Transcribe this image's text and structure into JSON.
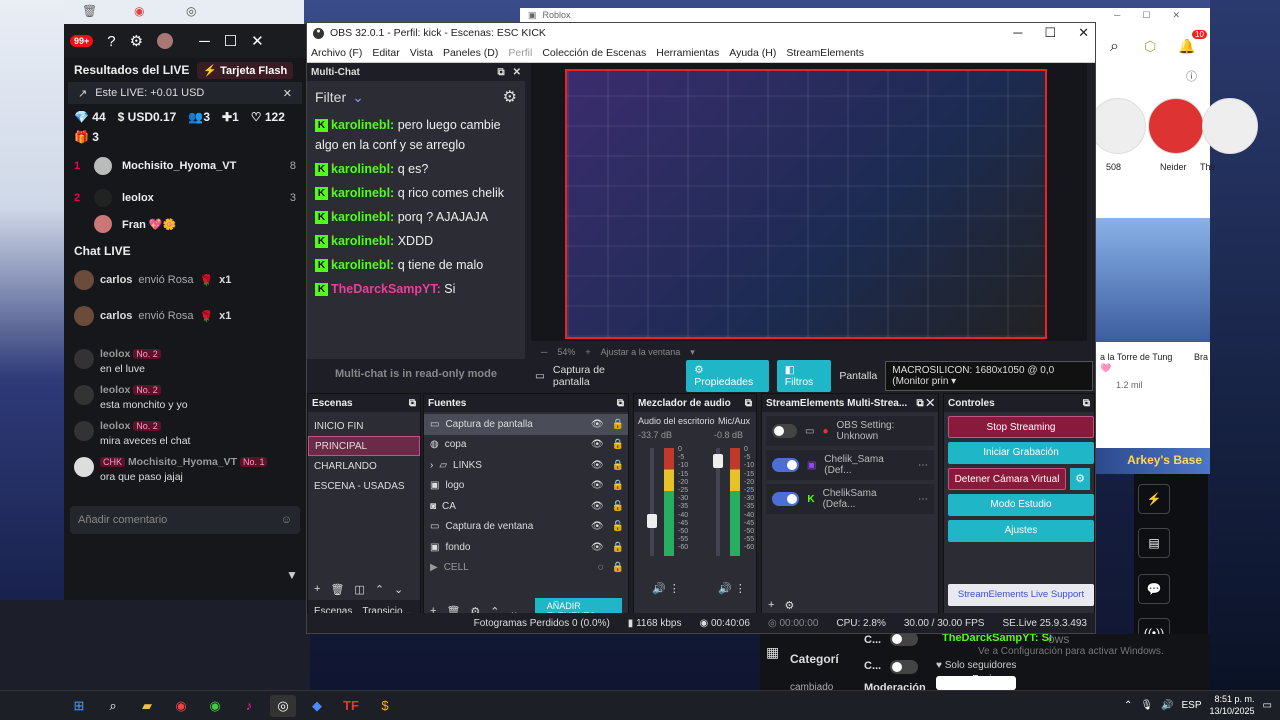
{
  "kick": {
    "notif_count": "99+",
    "header_title": "Resultados del LIVE",
    "tarjeta_flash": "Tarjeta Flash",
    "live_bar": "Este LIVE: +0.01 USD",
    "stats": {
      "diamonds": "44",
      "usd": "USD0.17",
      "users": "3",
      "fans": "1",
      "likes": "122",
      "gifts": "3"
    },
    "ranking": [
      {
        "n": "1",
        "name": "Mochisito_Hyoma_VT",
        "score": "8"
      },
      {
        "n": "2",
        "name": "leolox",
        "score": "3"
      },
      {
        "n": "",
        "name": "Fran 💖🌼",
        "score": ""
      }
    ],
    "chat_live_title": "Chat LIVE",
    "gifts": [
      {
        "user": "carlos",
        "text": "envió Rosa",
        "count": "x1"
      },
      {
        "user": "carlos",
        "text": "envió Rosa",
        "count": "x1"
      }
    ],
    "messages": [
      {
        "user": "leolox",
        "badge": "No. 2",
        "text": "en el luve"
      },
      {
        "user": "leolox",
        "badge": "No. 2",
        "text": "esta monchito y yo"
      },
      {
        "user": "leolox",
        "badge": "No. 2",
        "text": "mira aveces el chat"
      },
      {
        "user": "Mochisito_Hyoma_VT",
        "tag": "CHK",
        "badge": "No. 1",
        "text": "ora que paso jajaj"
      }
    ],
    "comment_placeholder": "Añadir comentario"
  },
  "obs": {
    "title": "OBS 32.0.1 - Perfil: kick - Escenas: ESC KICK",
    "menu": [
      "Archivo (F)",
      "Editar",
      "Vista",
      "Paneles (D)",
      "Perfil",
      "Colección de Escenas",
      "Herramientas",
      "Ayuda (H)",
      "StreamElements"
    ],
    "multichat": {
      "title": "Multi-Chat",
      "filter": "Filter",
      "lines": [
        {
          "user": "karolinebl:",
          "text": "pero luego cambie algo en la conf y se arreglo"
        },
        {
          "user": "karolinebl:",
          "text": "q es?"
        },
        {
          "user": "karolinebl:",
          "text": "q rico comes chelik"
        },
        {
          "user": "karolinebl:",
          "text": "porq ? AJAJAJA"
        },
        {
          "user": "karolinebl:",
          "text": "XDDD"
        },
        {
          "user": "karolinebl:",
          "text": "q tiene de malo"
        },
        {
          "user": "TheDarckSampYT:",
          "text": "Si"
        }
      ],
      "readonly": "Multi-chat is in read-only mode"
    },
    "zoom": "54%",
    "fit": "Ajustar a la ventana",
    "source_bar": {
      "source": "Captura de pantalla",
      "props": "Propiedades",
      "filters": "Filtros",
      "screen_label": "Pantalla",
      "screen_value": "MACROSILICON: 1680x1050 @ 0,0 (Monitor prin"
    },
    "scenes": {
      "title": "Escenas",
      "items": [
        "INICIO FIN",
        "PRINCIPAL",
        "CHARLANDO",
        "ESCENA - USADAS"
      ],
      "tab1": "Escenas",
      "tab2": "Transicio..."
    },
    "sources": {
      "title": "Fuentes",
      "items": [
        "Captura de pantalla",
        "copa",
        "LINKS",
        "logo",
        "CA",
        "Captura de ventana",
        "fondo",
        "CELL"
      ],
      "add_element": "AÑADIR ELEMENTO"
    },
    "mixer": {
      "title": "Mezclador de audio",
      "ch1": "Audio del escritorio",
      "ch1_db": "-33.7 dB",
      "ch2": "Mic/Aux",
      "ch2_db": "-0.8 dB",
      "scale": [
        "0",
        "-5",
        "-10",
        "-15",
        "-20",
        "-25",
        "-30",
        "-35",
        "-40",
        "-45",
        "-50",
        "-55",
        "-60"
      ]
    },
    "se": {
      "title": "StreamElements Multi-Strea...",
      "rows": [
        "OBS Setting: Unknown",
        "Chelik_Sama (Def...",
        "ChelikSama (Defa..."
      ]
    },
    "controls": {
      "title": "Controles",
      "stop": "Stop Streaming",
      "record": "Iniciar Grabación",
      "vcam": "Detener Cámara Virtual",
      "studio": "Modo Estudio",
      "settings": "Ajustes",
      "support": "StreamElements Live Support"
    },
    "status": {
      "dropped": "Fotogramas Perdidos 0 (0.0%)",
      "kbps": "1168 kbps",
      "live_time": "00:40:06",
      "rec_time": "00:00:00",
      "cpu": "CPU: 2.8%",
      "fps": "30.00 / 30.00 FPS",
      "version": "SE.Live 25.9.3.493"
    }
  },
  "roblox": {
    "title": "Roblox",
    "badge": "10",
    "friends": [
      {
        "name": "508"
      },
      {
        "name": "Neider"
      },
      {
        "name": "The"
      }
    ],
    "game_title": "a la Torre de Tung🩷",
    "game_stat": "1.2 mil",
    "game2": "Bra",
    "footer": "Arkey's Base"
  },
  "bottom": {
    "categoria": "Categorí",
    "cambiado": "cambiado",
    "moderacion": "Moderación",
    "chat_line": "TheDarckSampYT: Si",
    "activate": "Ve a Configuración para activar Windows.",
    "windows": "ows",
    "followers": "Solo seguidores",
    "send": "Enviar"
  },
  "taskbar": {
    "time": "8:51 p. m.",
    "date": "13/10/2025",
    "lang": "ESP"
  }
}
